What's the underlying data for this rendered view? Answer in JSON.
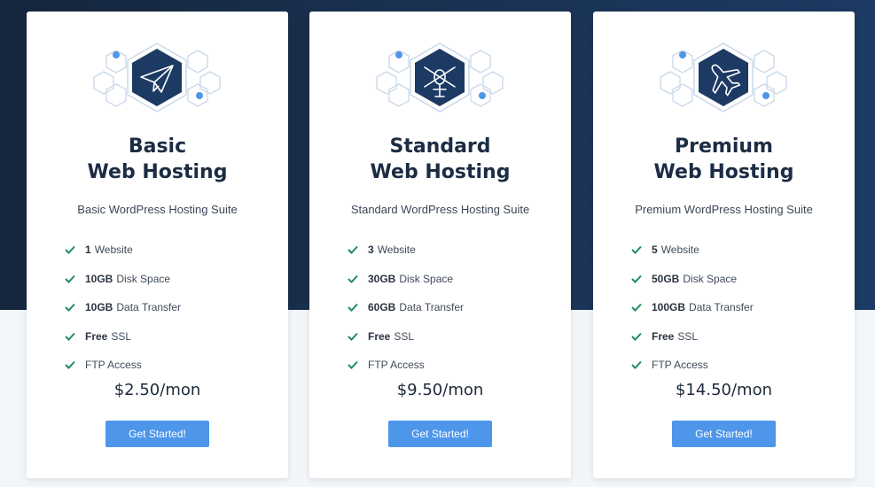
{
  "colors": {
    "accent": "#4d96ea",
    "check": "#1f8a68",
    "hex_dark": "#1c3a63",
    "hex_light": "#c9d8ea",
    "dot": "#4d96ea"
  },
  "plans": [
    {
      "icon": "paper-plane-icon",
      "title_line1": "Basic",
      "title_line2": "Web Hosting",
      "subtitle": "Basic WordPress Hosting Suite",
      "features": [
        {
          "bold": "1",
          "text": "Website"
        },
        {
          "bold": "10GB",
          "text": "Disk Space"
        },
        {
          "bold": "10GB",
          "text": "Data Transfer"
        },
        {
          "bold": "Free",
          "text": "SSL"
        },
        {
          "bold": "",
          "text": "FTP Access"
        }
      ],
      "price": "$2.50/mon",
      "button": "Get Started!"
    },
    {
      "icon": "helicopter-icon",
      "title_line1": "Standard",
      "title_line2": "Web Hosting",
      "subtitle": "Standard WordPress Hosting Suite",
      "features": [
        {
          "bold": "3",
          "text": "Website"
        },
        {
          "bold": "30GB",
          "text": "Disk Space"
        },
        {
          "bold": "60GB",
          "text": "Data Transfer"
        },
        {
          "bold": "Free",
          "text": "SSL"
        },
        {
          "bold": "",
          "text": "FTP Access"
        }
      ],
      "price": "$9.50/mon",
      "button": "Get Started!"
    },
    {
      "icon": "airplane-icon",
      "title_line1": "Premium",
      "title_line2": "Web Hosting",
      "subtitle": "Premium WordPress Hosting Suite",
      "features": [
        {
          "bold": "5",
          "text": "Website"
        },
        {
          "bold": "50GB",
          "text": "Disk Space"
        },
        {
          "bold": "100GB",
          "text": "Data Transfer"
        },
        {
          "bold": "Free",
          "text": "SSL"
        },
        {
          "bold": "",
          "text": "FTP Access"
        }
      ],
      "price": "$14.50/mon",
      "button": "Get Started!"
    }
  ]
}
